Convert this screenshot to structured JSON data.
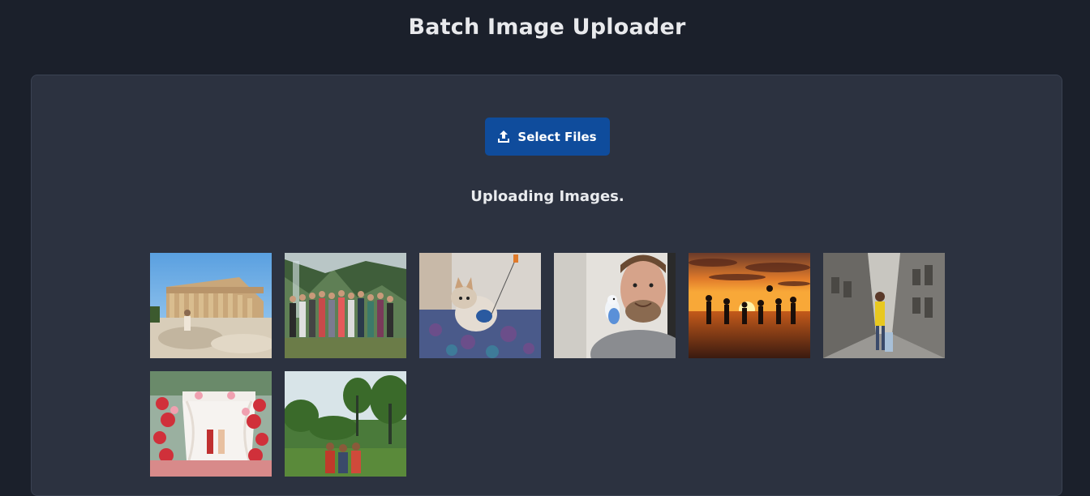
{
  "app": {
    "title": "Batch Image Uploader"
  },
  "uploader": {
    "select_files_label": "Select Files",
    "upload_icon": "upload-icon",
    "status": "Uploading Images."
  },
  "thumbnails": [
    {
      "subject": "parthenon-ruins"
    },
    {
      "subject": "group-in-mountains"
    },
    {
      "subject": "kitten-with-toy"
    },
    {
      "subject": "man-with-parakeet"
    },
    {
      "subject": "sunset-beach-silhouettes"
    },
    {
      "subject": "traveler-in-alley"
    },
    {
      "subject": "wedding-floral-mandap"
    },
    {
      "subject": "couple-in-forest"
    }
  ],
  "colors": {
    "background": "#1b202b",
    "panel": "#2c3240",
    "button": "#0f4c9c",
    "text": "#e8e9ec"
  }
}
